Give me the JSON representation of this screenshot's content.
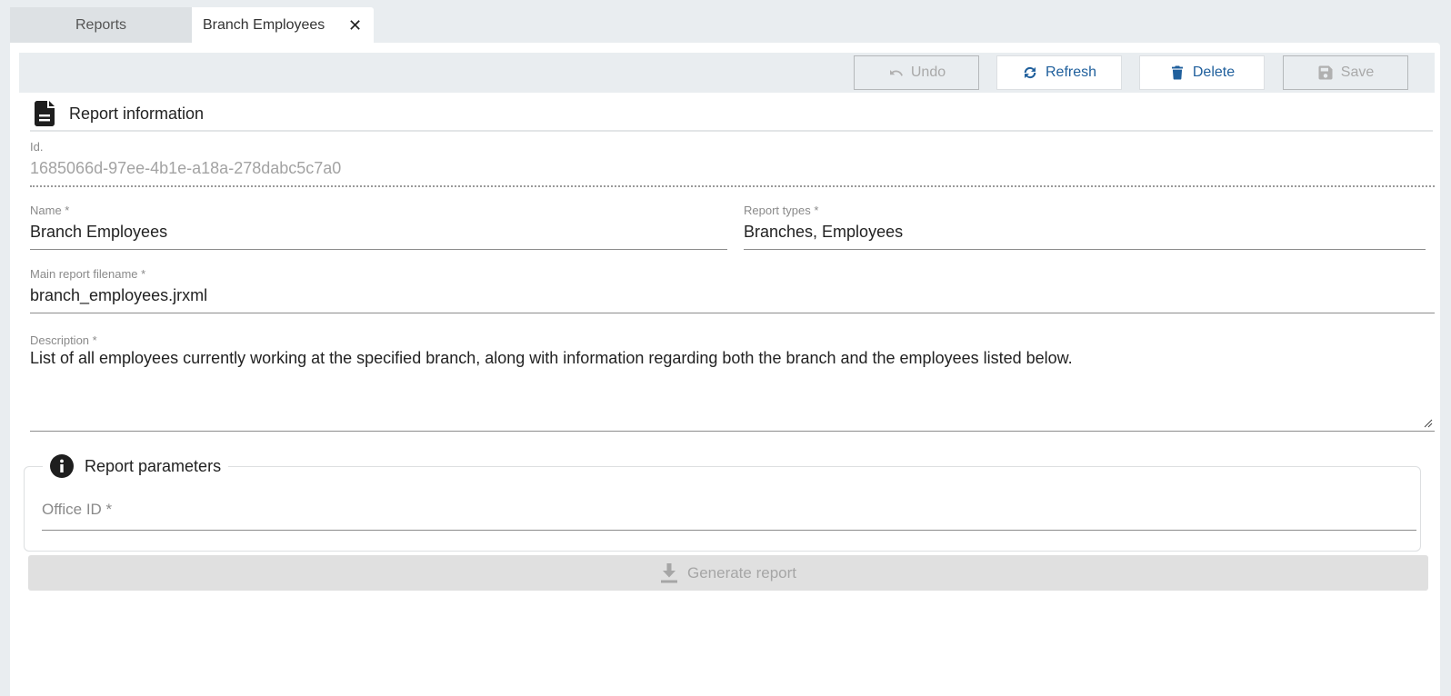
{
  "tabs": [
    {
      "label": "Reports",
      "active": false
    },
    {
      "label": "Branch Employees",
      "active": true,
      "close_icon": "close-icon"
    }
  ],
  "toolbar": {
    "undo": {
      "label": "Undo",
      "icon": "undo-icon",
      "disabled": true
    },
    "refresh": {
      "label": "Refresh",
      "icon": "refresh-icon",
      "disabled": false
    },
    "delete": {
      "label": "Delete",
      "icon": "trash-icon",
      "disabled": false
    },
    "save": {
      "label": "Save",
      "icon": "floppy-disk-icon",
      "disabled": true
    }
  },
  "colors": {
    "accent": "#1f5f9c",
    "disabled_text": "#a9a9a9",
    "background": "#e9edf0"
  },
  "report_information": {
    "title": "Report information",
    "icon": "file-document-icon",
    "fields": {
      "id": {
        "label": "Id.",
        "value": "1685066d-97ee-4b1e-a18a-278dabc5c7a0"
      },
      "name": {
        "label": "Name *",
        "value": "Branch Employees"
      },
      "report_types": {
        "label": "Report types *",
        "value": "Branches, Employees"
      },
      "main_filename": {
        "label": "Main report filename *",
        "value": "branch_employees.jrxml"
      },
      "description": {
        "label": "Description *",
        "value": "List of all employees currently working at the specified branch, along with information regarding both the branch and the employees listed below."
      }
    }
  },
  "report_parameters": {
    "title": "Report parameters",
    "icon": "info-circle-icon",
    "office_id": {
      "placeholder": "Office ID *",
      "value": ""
    }
  },
  "generate": {
    "label": "Generate report",
    "icon": "download-icon",
    "disabled": true
  }
}
